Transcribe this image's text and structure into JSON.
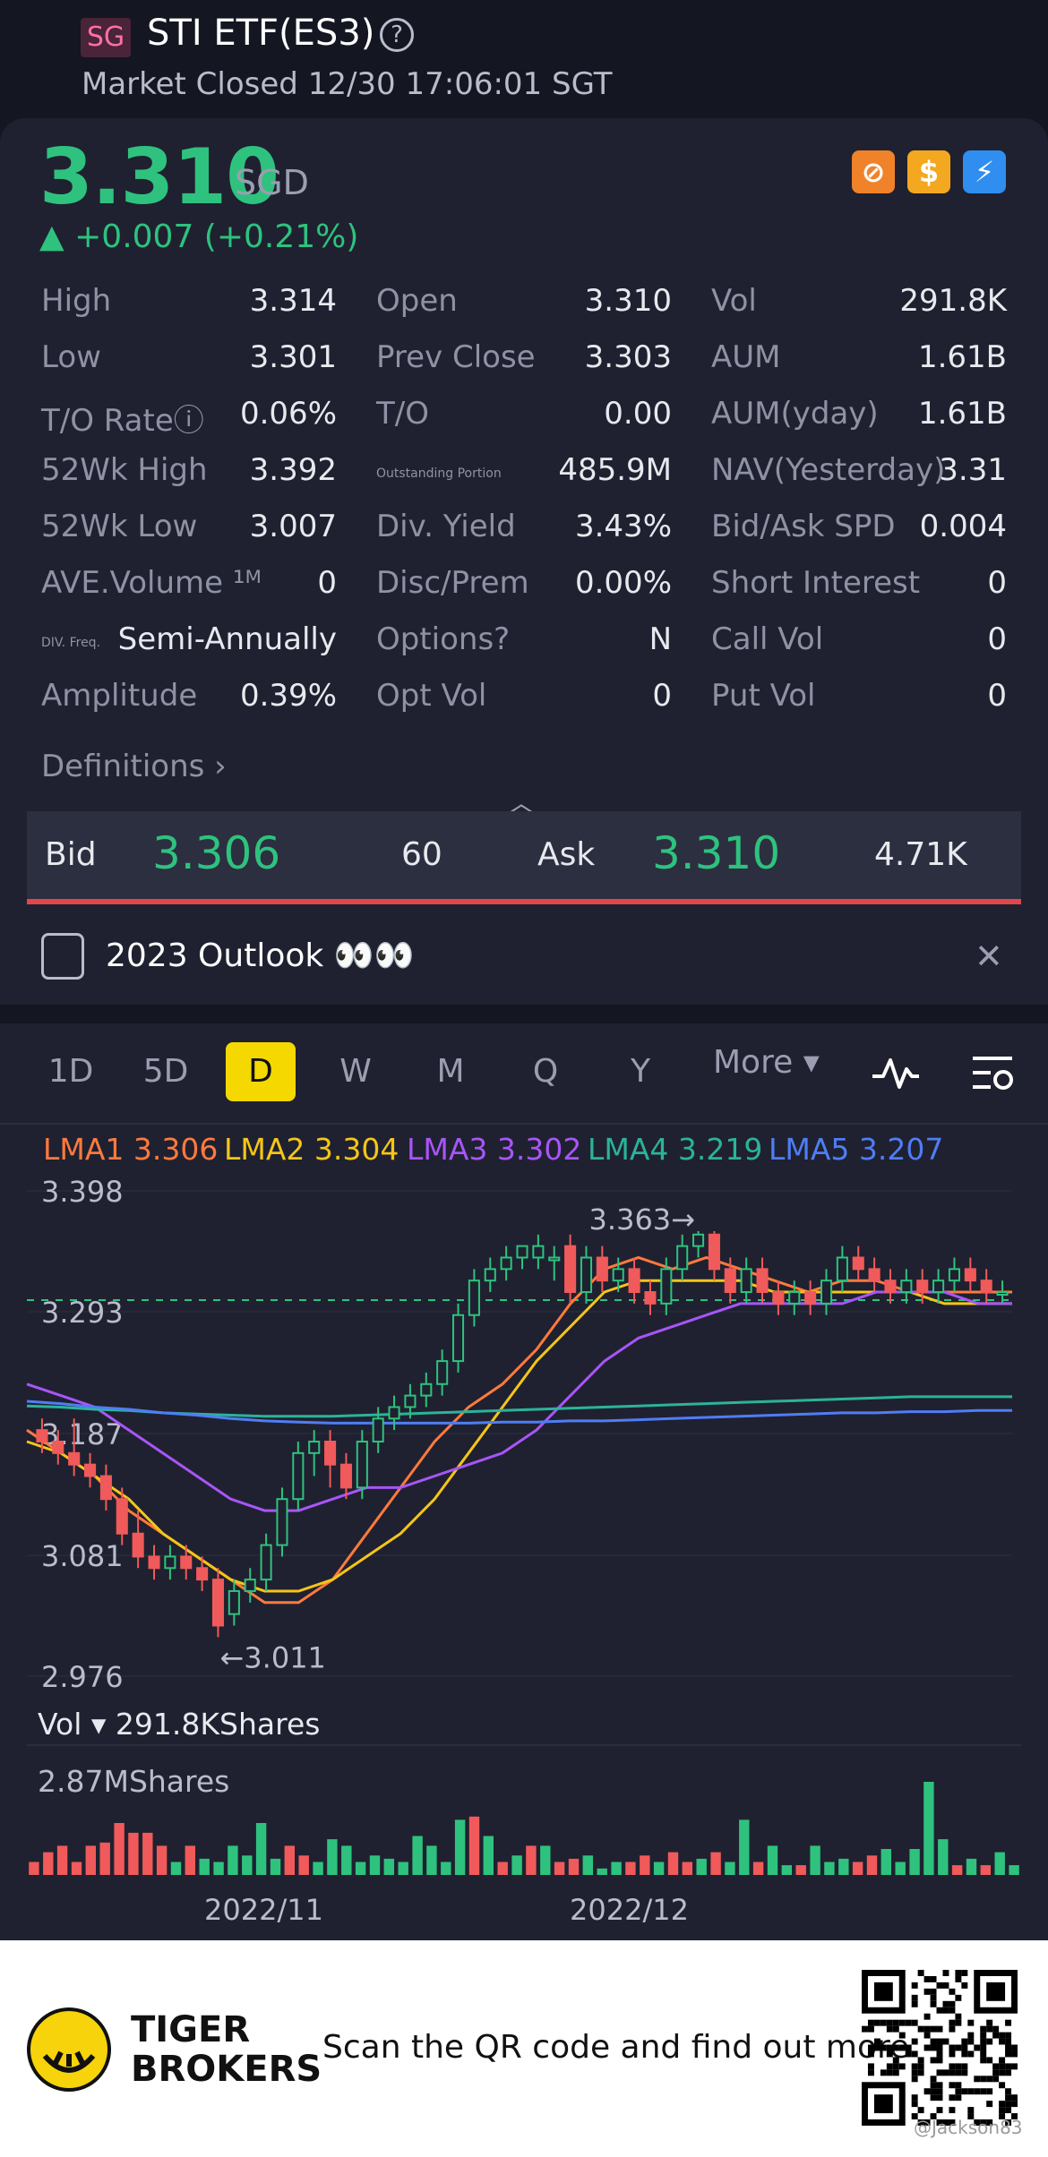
{
  "header": {
    "region_badge": "SG",
    "title": "STI ETF(ES3)",
    "help_icon": "?",
    "status": "Market Closed 12/30 17:06:01 SGT"
  },
  "quote": {
    "price": "3.310",
    "currency": "SGD",
    "change": "▲ +0.007 (+0.21%)",
    "badges": [
      {
        "icon": "no-margin-icon",
        "glyph": "⊘"
      },
      {
        "icon": "dollar-icon",
        "glyph": "$"
      },
      {
        "icon": "lightning-icon",
        "glyph": "⚡"
      }
    ]
  },
  "stats": [
    [
      {
        "label": "High",
        "value": "3.314"
      },
      {
        "label": "Open",
        "value": "3.310"
      },
      {
        "label": "Vol",
        "value": "291.8K"
      }
    ],
    [
      {
        "label": "Low",
        "value": "3.301"
      },
      {
        "label": "Prev Close",
        "value": "3.303"
      },
      {
        "label": "AUM",
        "value": "1.61B"
      }
    ],
    [
      {
        "label": "T/O Rateⓘ",
        "value": "0.06%"
      },
      {
        "label": "T/O",
        "value": "0.00"
      },
      {
        "label": "AUM(yday)",
        "value": "1.61B"
      }
    ],
    [
      {
        "label": "52Wk High",
        "value": "3.392"
      },
      {
        "label": "Outstanding Portion",
        "value": "485.9M"
      },
      {
        "label": "NAV(Yesterday)",
        "value": "3.31"
      }
    ],
    [
      {
        "label": "52Wk Low",
        "value": "3.007"
      },
      {
        "label": "Div. Yield",
        "value": "3.43%"
      },
      {
        "label": "Bid/Ask SPD",
        "value": "0.004"
      }
    ],
    [
      {
        "label": "AVE.Volume ¹ᴹ",
        "value": "0"
      },
      {
        "label": "Disc/Prem",
        "value": "0.00%"
      },
      {
        "label": "Short Interest",
        "value": "0"
      }
    ],
    [
      {
        "label": "DIV. Freq.",
        "value": "Semi-Annually"
      },
      {
        "label": "Options?",
        "value": "N"
      },
      {
        "label": "Call Vol",
        "value": "0"
      }
    ],
    [
      {
        "label": "Amplitude",
        "value": "0.39%"
      },
      {
        "label": "Opt Vol",
        "value": "0"
      },
      {
        "label": "Put Vol",
        "value": "0"
      }
    ]
  ],
  "definitions_label": "Definitions",
  "bidask": {
    "bid_label": "Bid",
    "bid_price": "3.306",
    "bid_size": "60",
    "ask_label": "Ask",
    "ask_price": "3.310",
    "ask_size": "4.71K"
  },
  "outlook": {
    "text": "2023 Outlook 👀👀",
    "close": "✕"
  },
  "periods": [
    "1D",
    "5D",
    "D",
    "W",
    "M",
    "Q",
    "Y"
  ],
  "active_period": "D",
  "more_label": "More ▾",
  "lma": [
    {
      "label": "LMA1 3.306",
      "color": "#ff7a3d"
    },
    {
      "label": "LMA2 3.304",
      "color": "#f5c518"
    },
    {
      "label": "LMA3 3.302",
      "color": "#a855f7"
    },
    {
      "label": "LMA4 3.219",
      "color": "#2bb39a"
    },
    {
      "label": "LMA5 3.207",
      "color": "#4f7df5"
    }
  ],
  "chart_data": {
    "type": "candlestick",
    "y_axis_labels": [
      "3.398",
      "3.293",
      "3.187",
      "3.081",
      "2.976"
    ],
    "ylim": [
      2.976,
      3.398
    ],
    "high_annotation": "3.363",
    "low_annotation": "3.011",
    "x_labels": [
      "2022/11",
      "2022/12"
    ],
    "candles": [
      [
        3.19,
        3.18,
        3.2,
        3.17
      ],
      [
        3.18,
        3.17,
        3.19,
        3.16
      ],
      [
        3.17,
        3.16,
        3.2,
        3.15
      ],
      [
        3.16,
        3.15,
        3.17,
        3.14
      ],
      [
        3.15,
        3.13,
        3.16,
        3.12
      ],
      [
        3.13,
        3.1,
        3.14,
        3.09
      ],
      [
        3.1,
        3.08,
        3.12,
        3.07
      ],
      [
        3.08,
        3.07,
        3.09,
        3.06
      ],
      [
        3.07,
        3.08,
        3.09,
        3.06
      ],
      [
        3.08,
        3.07,
        3.09,
        3.06
      ],
      [
        3.07,
        3.06,
        3.08,
        3.05
      ],
      [
        3.06,
        3.02,
        3.07,
        3.01
      ],
      [
        3.03,
        3.05,
        3.06,
        3.02
      ],
      [
        3.05,
        3.06,
        3.07,
        3.04
      ],
      [
        3.06,
        3.09,
        3.1,
        3.05
      ],
      [
        3.09,
        3.13,
        3.14,
        3.08
      ],
      [
        3.13,
        3.17,
        3.18,
        3.12
      ],
      [
        3.17,
        3.18,
        3.19,
        3.15
      ],
      [
        3.18,
        3.16,
        3.19,
        3.14
      ],
      [
        3.16,
        3.14,
        3.17,
        3.13
      ],
      [
        3.14,
        3.18,
        3.19,
        3.13
      ],
      [
        3.18,
        3.2,
        3.21,
        3.17
      ],
      [
        3.2,
        3.21,
        3.22,
        3.19
      ],
      [
        3.21,
        3.22,
        3.23,
        3.2
      ],
      [
        3.22,
        3.23,
        3.24,
        3.21
      ],
      [
        3.23,
        3.25,
        3.26,
        3.22
      ],
      [
        3.25,
        3.29,
        3.3,
        3.24
      ],
      [
        3.29,
        3.32,
        3.33,
        3.28
      ],
      [
        3.32,
        3.33,
        3.34,
        3.31
      ],
      [
        3.33,
        3.34,
        3.35,
        3.32
      ],
      [
        3.34,
        3.35,
        3.35,
        3.33
      ],
      [
        3.34,
        3.35,
        3.36,
        3.33
      ],
      [
        3.34,
        3.34,
        3.35,
        3.32
      ],
      [
        3.35,
        3.31,
        3.36,
        3.3
      ],
      [
        3.31,
        3.34,
        3.35,
        3.3
      ],
      [
        3.34,
        3.32,
        3.35,
        3.31
      ],
      [
        3.32,
        3.33,
        3.34,
        3.31
      ],
      [
        3.33,
        3.31,
        3.34,
        3.3
      ],
      [
        3.31,
        3.3,
        3.32,
        3.29
      ],
      [
        3.3,
        3.33,
        3.34,
        3.29
      ],
      [
        3.33,
        3.35,
        3.36,
        3.32
      ],
      [
        3.35,
        3.36,
        3.363,
        3.34
      ],
      [
        3.36,
        3.33,
        3.363,
        3.32
      ],
      [
        3.33,
        3.31,
        3.34,
        3.3
      ],
      [
        3.31,
        3.33,
        3.34,
        3.3
      ],
      [
        3.33,
        3.31,
        3.34,
        3.3
      ],
      [
        3.31,
        3.3,
        3.32,
        3.29
      ],
      [
        3.3,
        3.31,
        3.32,
        3.29
      ],
      [
        3.31,
        3.3,
        3.32,
        3.29
      ],
      [
        3.3,
        3.32,
        3.33,
        3.29
      ],
      [
        3.32,
        3.34,
        3.35,
        3.31
      ],
      [
        3.34,
        3.33,
        3.35,
        3.32
      ],
      [
        3.33,
        3.32,
        3.34,
        3.31
      ],
      [
        3.32,
        3.31,
        3.33,
        3.3
      ],
      [
        3.31,
        3.32,
        3.33,
        3.3
      ],
      [
        3.32,
        3.31,
        3.33,
        3.3
      ],
      [
        3.31,
        3.32,
        3.33,
        3.3
      ],
      [
        3.32,
        3.33,
        3.34,
        3.31
      ],
      [
        3.33,
        3.32,
        3.34,
        3.31
      ],
      [
        3.32,
        3.31,
        3.33,
        3.3
      ],
      [
        3.31,
        3.31,
        3.32,
        3.3
      ]
    ],
    "ma_series": [
      {
        "name": "LMA1",
        "values": [
          3.19,
          3.17,
          3.15,
          3.12,
          3.1,
          3.08,
          3.06,
          3.04,
          3.04,
          3.06,
          3.1,
          3.14,
          3.18,
          3.21,
          3.23,
          3.26,
          3.3,
          3.33,
          3.34,
          3.33,
          3.34,
          3.33,
          3.32,
          3.31,
          3.32,
          3.32,
          3.31,
          3.31,
          3.31,
          3.31
        ]
      },
      {
        "name": "LMA2",
        "values": [
          3.18,
          3.17,
          3.15,
          3.13,
          3.1,
          3.08,
          3.06,
          3.05,
          3.05,
          3.06,
          3.08,
          3.1,
          3.13,
          3.17,
          3.21,
          3.25,
          3.28,
          3.31,
          3.32,
          3.32,
          3.32,
          3.32,
          3.31,
          3.31,
          3.31,
          3.31,
          3.31,
          3.3,
          3.3,
          3.3
        ]
      },
      {
        "name": "LMA3",
        "values": [
          3.23,
          3.22,
          3.21,
          3.19,
          3.17,
          3.15,
          3.13,
          3.12,
          3.12,
          3.13,
          3.14,
          3.14,
          3.15,
          3.16,
          3.17,
          3.19,
          3.22,
          3.25,
          3.27,
          3.28,
          3.29,
          3.3,
          3.3,
          3.3,
          3.3,
          3.31,
          3.31,
          3.31,
          3.3,
          3.3
        ]
      },
      {
        "name": "LMA4",
        "values": [
          3.211,
          3.21,
          3.208,
          3.207,
          3.205,
          3.204,
          3.203,
          3.202,
          3.202,
          3.202,
          3.203,
          3.204,
          3.205,
          3.206,
          3.207,
          3.208,
          3.209,
          3.21,
          3.211,
          3.212,
          3.213,
          3.214,
          3.215,
          3.216,
          3.217,
          3.218,
          3.219,
          3.219,
          3.219,
          3.219
        ]
      },
      {
        "name": "LMA5",
        "values": [
          3.215,
          3.213,
          3.21,
          3.208,
          3.205,
          3.203,
          3.2,
          3.198,
          3.197,
          3.196,
          3.196,
          3.196,
          3.196,
          3.196,
          3.197,
          3.197,
          3.198,
          3.198,
          3.199,
          3.2,
          3.201,
          3.202,
          3.203,
          3.204,
          3.205,
          3.205,
          3.206,
          3.206,
          3.207,
          3.207
        ]
      }
    ],
    "prev_close": 3.303,
    "volume_label": "Vol ▾  291.8KShares",
    "volume_max_label": "2.87MShares",
    "volume": {
      "max": 2.87,
      "values": [
        0.4,
        0.7,
        0.9,
        0.4,
        0.9,
        1.0,
        1.6,
        1.3,
        1.3,
        0.9,
        0.4,
        0.9,
        0.5,
        0.4,
        0.9,
        0.6,
        1.6,
        0.5,
        0.9,
        0.6,
        0.4,
        1.1,
        0.9,
        0.4,
        0.6,
        0.5,
        0.4,
        1.2,
        0.9,
        0.4,
        1.7,
        1.8,
        1.2,
        0.4,
        0.6,
        0.9,
        0.9,
        0.4,
        0.5,
        0.6,
        0.2,
        0.4,
        0.4,
        0.6,
        0.4,
        0.7,
        0.4,
        0.5,
        0.7,
        0.4,
        1.7,
        0.4,
        0.9,
        0.3,
        0.3,
        0.9,
        0.4,
        0.5,
        0.4,
        0.6,
        0.8,
        0.4,
        0.8,
        2.87,
        1.1,
        0.3,
        0.5,
        0.3,
        0.7,
        0.3
      ],
      "up": [
        0,
        0,
        0,
        0,
        0,
        0,
        0,
        0,
        0,
        0,
        1,
        0,
        1,
        1,
        1,
        1,
        1,
        1,
        0,
        0,
        1,
        1,
        1,
        1,
        1,
        1,
        1,
        1,
        1,
        1,
        1,
        0,
        1,
        0,
        1,
        0,
        1,
        0,
        0,
        1,
        1,
        1,
        0,
        0,
        1,
        0,
        0,
        1,
        0,
        1,
        1,
        0,
        1,
        1,
        0,
        1,
        1,
        1,
        0,
        0,
        1,
        1,
        1,
        1,
        1,
        0,
        1,
        0,
        1,
        1
      ]
    }
  },
  "footer": {
    "brand_line1": "TIGER",
    "brand_line2": "BROKERS",
    "tagline": "Scan the QR code and find out more",
    "watermark": "@Jackson83"
  }
}
